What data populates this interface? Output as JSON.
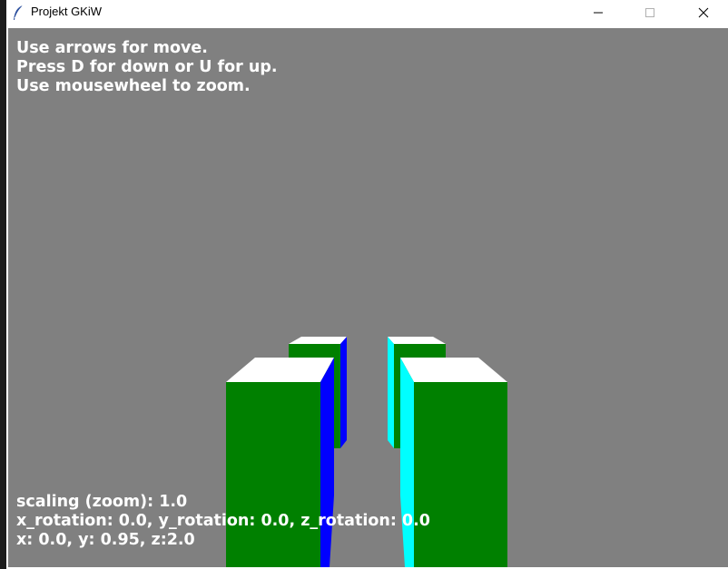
{
  "window": {
    "title": "Projekt GKiW",
    "app_icon": "feather-icon",
    "controls": {
      "minimize_icon": "minimize-icon",
      "maximize_icon": "maximize-icon",
      "close_icon": "close-icon"
    }
  },
  "instructions": {
    "line1": "Use arrows for move.",
    "line2": "Press D for down or U for up.",
    "line3": "Use mousewheel to zoom."
  },
  "status": {
    "scaling": "scaling (zoom): 1.0",
    "rotation": "x_rotation: 0.0, y_rotation: 0.0, z_rotation: 0.0",
    "position": "x: 0.0, y: 0.95, z:2.0"
  },
  "scene": {
    "background_color": "#808080",
    "front_face_color": "#008000",
    "top_face_color": "#ffffff",
    "left_pillar_side_color": "#0000ff",
    "right_pillar_side_color": "#00ffff"
  }
}
